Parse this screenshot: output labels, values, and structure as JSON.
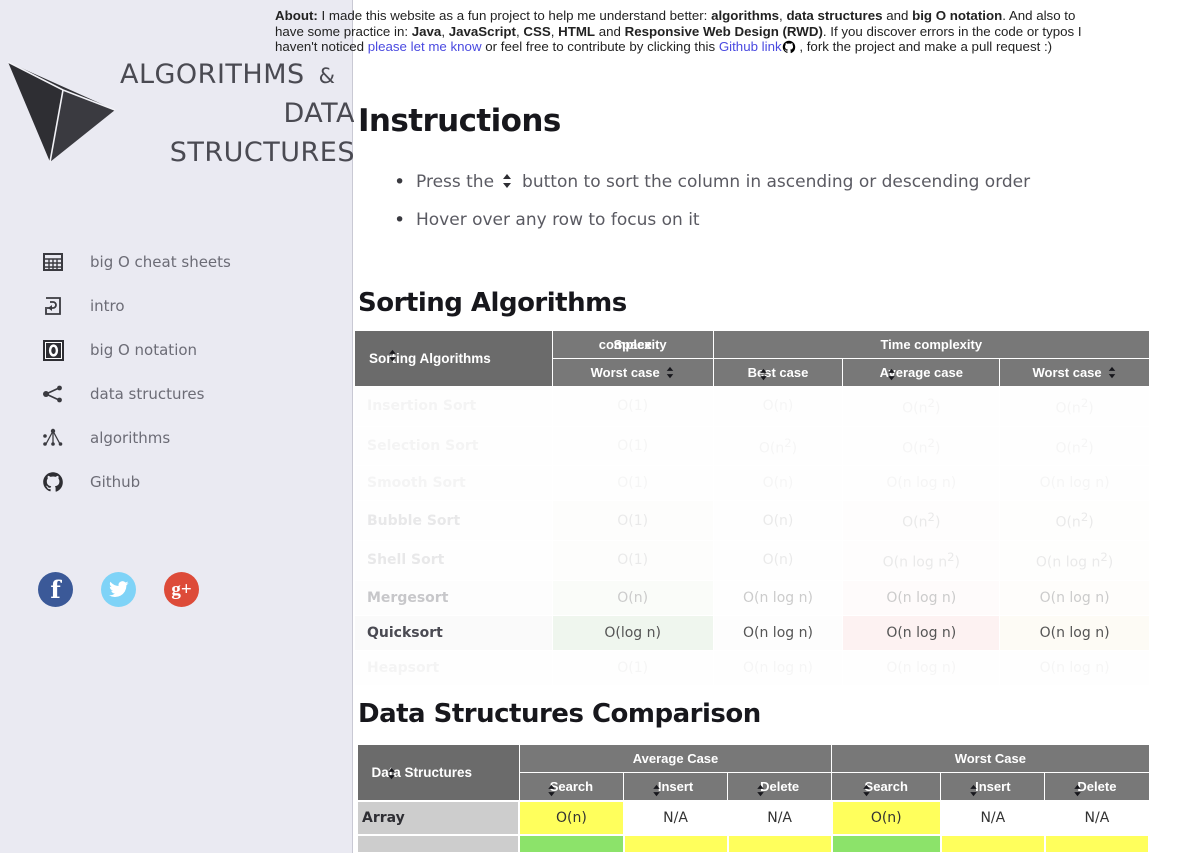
{
  "about": {
    "label": "About:",
    "t1": " I made this website as a fun project to help me understand better: ",
    "b1": "algorithms",
    "t2": ", ",
    "b2": "data structures",
    "t3": " and ",
    "b3": "big O notation",
    "t4": ". And also to have some practice in: ",
    "b4": "Java",
    "t5": ", ",
    "b5": "JavaScript",
    "t6": ", ",
    "b6": "CSS",
    "t7": ", ",
    "b7": "HTML",
    "t8": " and ",
    "b8": "Responsive Web Design (RWD)",
    "t9": ". If you discover errors in the code or typos I haven't noticed ",
    "link1": "please let me know",
    "t10": " or feel free to contribute by clicking this ",
    "link2": "Github link",
    "t11": " , fork the project and make a pull request :)"
  },
  "logo": {
    "line1": "ALGORITHMS",
    "amp": "&",
    "line2": "DATA STRUCTURES"
  },
  "sidebar": {
    "items": [
      {
        "label": "big O cheat sheets",
        "icon": "grid-table-icon"
      },
      {
        "label": "intro",
        "icon": "enter-arrow-icon"
      },
      {
        "label": "big O notation",
        "icon": "big-o-icon"
      },
      {
        "label": "data structures",
        "icon": "node-graph-icon"
      },
      {
        "label": "algorithms",
        "icon": "network-nodes-icon"
      },
      {
        "label": "Github",
        "icon": "github-icon"
      }
    ],
    "socials": [
      {
        "name": "facebook",
        "glyph": "f",
        "color": "#3b5998"
      },
      {
        "name": "twitter",
        "glyph": "❦",
        "color": "#7fd3f7"
      },
      {
        "name": "googleplus",
        "glyph": "g+",
        "color": "#dd4b39"
      }
    ]
  },
  "instructions": {
    "title": "Instructions",
    "bullet1_pre": "Press the",
    "bullet1_post": "button to sort the column in ascending or descending order",
    "bullet2": "Hover over any row to focus on it"
  },
  "sorting": {
    "title": "Sorting Algorithms",
    "corner": "Sorting Algorithms",
    "group_space": "Space complexity",
    "group_space_overlap_a": "complexity",
    "group_space_overlap_b": "Space",
    "group_time": "Time complexity",
    "sub_headers": [
      "Worst case",
      "Best case",
      "Average case",
      "Worst case"
    ],
    "rows": [
      {
        "name": "Insertion Sort",
        "space": "O(1)",
        "best": "O(n)",
        "avg": "O(n²)",
        "worst": "O(n²)",
        "fade": "faded"
      },
      {
        "name": "Selection Sort",
        "space": "O(1)",
        "best": "O(n²)",
        "avg": "O(n²)",
        "worst": "O(n²)",
        "fade": "faded"
      },
      {
        "name": "Smooth Sort",
        "space": "O(1)",
        "best": "O(n)",
        "avg": "O(n log n)",
        "worst": "O(n log n)",
        "fade": "faded"
      },
      {
        "name": "Bubble Sort",
        "space": "O(1)",
        "best": "O(n)",
        "avg": "O(n²)",
        "worst": "O(n²)",
        "fade": "faded2"
      },
      {
        "name": "Shell Sort",
        "space": "O(1)",
        "best": "O(n)",
        "avg": "O(n log n²)",
        "worst": "O(n log n²)",
        "fade": "faded2"
      },
      {
        "name": "Mergesort",
        "space": "O(n)",
        "best": "O(n log n)",
        "avg": "O(n log n)",
        "worst": "O(n log n)",
        "fade": "faded3"
      },
      {
        "name": "Quicksort",
        "space": "O(log n)",
        "best": "O(n log n)",
        "avg": "O(n log n)",
        "worst": "O(n log n)",
        "fade": "solid"
      },
      {
        "name": "Heapsort",
        "space": "O(1)",
        "best": "O(n log n)",
        "avg": "O(n log n)",
        "worst": "O(n log n)",
        "fade": "faded"
      }
    ]
  },
  "datastructures": {
    "title": "Data Structures Comparison",
    "corner": "Data Structures",
    "group_average": "Average Case",
    "group_worst": "Worst Case",
    "sub_headers": [
      "Search",
      "Insert",
      "Delete",
      "Search",
      "Insert",
      "Delete"
    ],
    "rows": [
      {
        "name": "Array",
        "cells": [
          {
            "v": "O(n)",
            "c": "ds-yellow"
          },
          {
            "v": "N/A",
            "c": "ds-na"
          },
          {
            "v": "N/A",
            "c": "ds-na"
          },
          {
            "v": "O(n)",
            "c": "ds-yellow"
          },
          {
            "v": "N/A",
            "c": "ds-na"
          },
          {
            "v": "N/A",
            "c": "ds-na"
          }
        ]
      },
      {
        "name": "",
        "cells": [
          {
            "v": "",
            "c": "ds-green"
          },
          {
            "v": "",
            "c": "ds-yellow"
          },
          {
            "v": "",
            "c": "ds-yellow"
          },
          {
            "v": "",
            "c": "ds-green"
          },
          {
            "v": "",
            "c": "ds-yellow"
          },
          {
            "v": "",
            "c": "ds-yellow"
          }
        ]
      }
    ]
  },
  "colors": {
    "sidebar_bg": "#eaeaf2",
    "header_grey": "#787878",
    "corner_grey": "#6b6b6b",
    "link_blue": "#4a4ae0",
    "yellow": "#ffff5c",
    "green": "#8ce36a"
  }
}
